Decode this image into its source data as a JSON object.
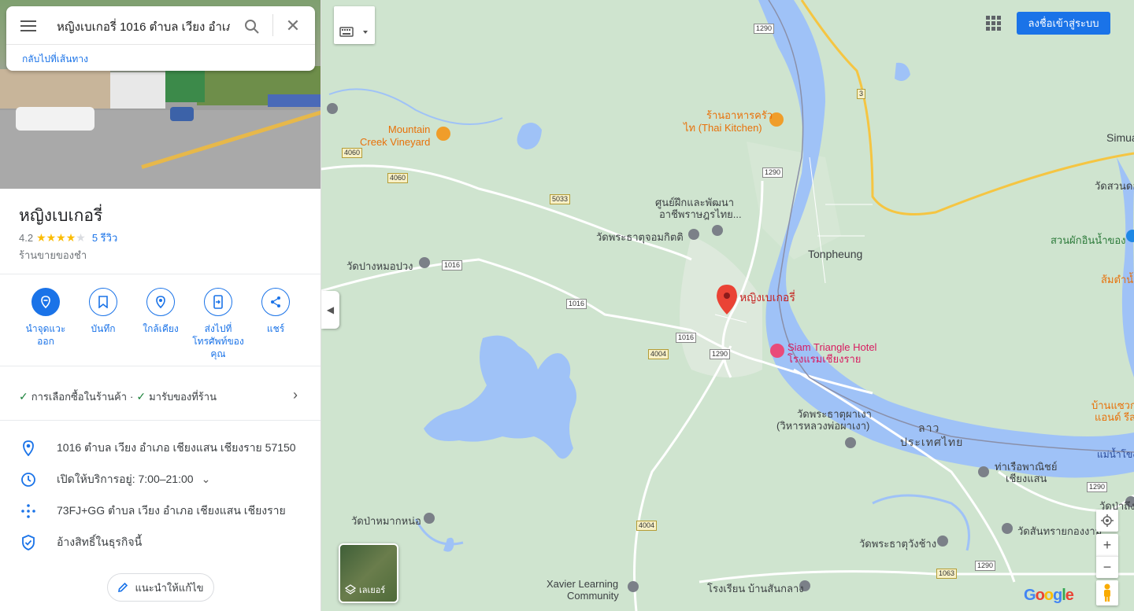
{
  "search": {
    "query": "หญิงเบเกอรี่ 1016 ตำบล เวียง อำเภ",
    "back_link": "กลับไปที่เส้นทาง"
  },
  "place": {
    "name": "หญิงเบเกอรี่",
    "rating": "4.2",
    "rating_value": 4.2,
    "stars_filled": 4,
    "reviews": "5 รีวิว",
    "category": "ร้านขายของชำ"
  },
  "actions": [
    {
      "label": "นำจุดแวะออก",
      "icon": "remove-stop-icon"
    },
    {
      "label": "บันทึก",
      "icon": "bookmark-icon"
    },
    {
      "label": "ใกล้เคียง",
      "icon": "nearby-icon"
    },
    {
      "label": "ส่งไปที่โทรศัพท์ของคุณ",
      "icon": "send-to-phone-icon"
    },
    {
      "label": "แชร์",
      "icon": "share-icon"
    }
  ],
  "features": {
    "item1": "การเลือกซื้อในร้านค้า",
    "dot": "·",
    "item2": "มารับของที่ร้าน"
  },
  "info": {
    "address": "1016 ตำบล เวียง อำเภอ เชียงแสน เชียงราย 57150",
    "hours": "เปิดให้บริการอยู่:  7:00–21:00",
    "plus_code": "73FJ+GG ตำบล เวียง อำเภอ เชียงแสน เชียงราย",
    "claim": "อ้างสิทธิ์ในธุรกิจนี้"
  },
  "suggest_edit": "แนะนำให้แก้ไข",
  "topbar": {
    "signin": "ลงชื่อเข้าสู่ระบบ"
  },
  "layers_label": "เลเยอร์",
  "google_logo": "Google",
  "map_labels": {
    "mountain_creek": "Mountain\nCreek Vineyard",
    "thai_kitchen1": "ร้านอาหารครัว",
    "thai_kitchen2": "ไท (Thai Kitchen)",
    "center1": "ศูนย์ฝึกและพัฒนา",
    "center2": "อาชีพราษฎรไทย...",
    "wat_chom_kitti": "วัดพระธาตุจอมกิตติ",
    "wat_pang_mo_pong": "วัดปางหมอปวง",
    "tonpheung": "Tonpheung",
    "pin_name": "หญิงเบเกอรี่",
    "siam_triangle1": "Siam Triangle Hotel",
    "siam_triangle2": "โรงแรมเชียงราย",
    "wat_pha_ngao1": "วัดพระธาตุผาเงา",
    "wat_pha_ngao2": "(วิหารหลวงพ่อผาเงา)",
    "port1": "ท่าเรือพาณิชย์",
    "port2": "เชียงแสน",
    "wat_pa_mak": "วัดป่าหมากหน่อ",
    "wat_pha_that_wang_chang": "วัดพระธาตุวังช้าง",
    "xavier1": "Xavier Learning",
    "xavier2": "Community",
    "school": "โรงเรียน บ้านสันกลาง",
    "wat_san_sai": "วัดสันทรายกองงาม",
    "simua": "Simua",
    "wat_suan_dok": "วัดสวนดอก",
    "suan_phak": "สวนผักอินน้ำของ",
    "som_tam": "ส้มตำน้ำรา",
    "ban_waeng1": "บ้านแซวก",
    "ban_waeng2": "แอนด์ รีส",
    "wat_pa_tueng": "วัดป่าถึง",
    "laos": "ลาว",
    "thailand": "ประเทศไทย",
    "mekong": "แม่น้ำโขง"
  },
  "road_shields": [
    "1290",
    "3",
    "4060",
    "4060",
    "5033",
    "1016",
    "1016",
    "1016",
    "4004",
    "1290",
    "1290",
    "4004",
    "1063",
    "1290",
    "1290"
  ],
  "colors": {
    "map_land": "#cfe4cf",
    "water": "#9fc2f7",
    "accent": "#1a73e8",
    "pin": "#ea4335"
  }
}
